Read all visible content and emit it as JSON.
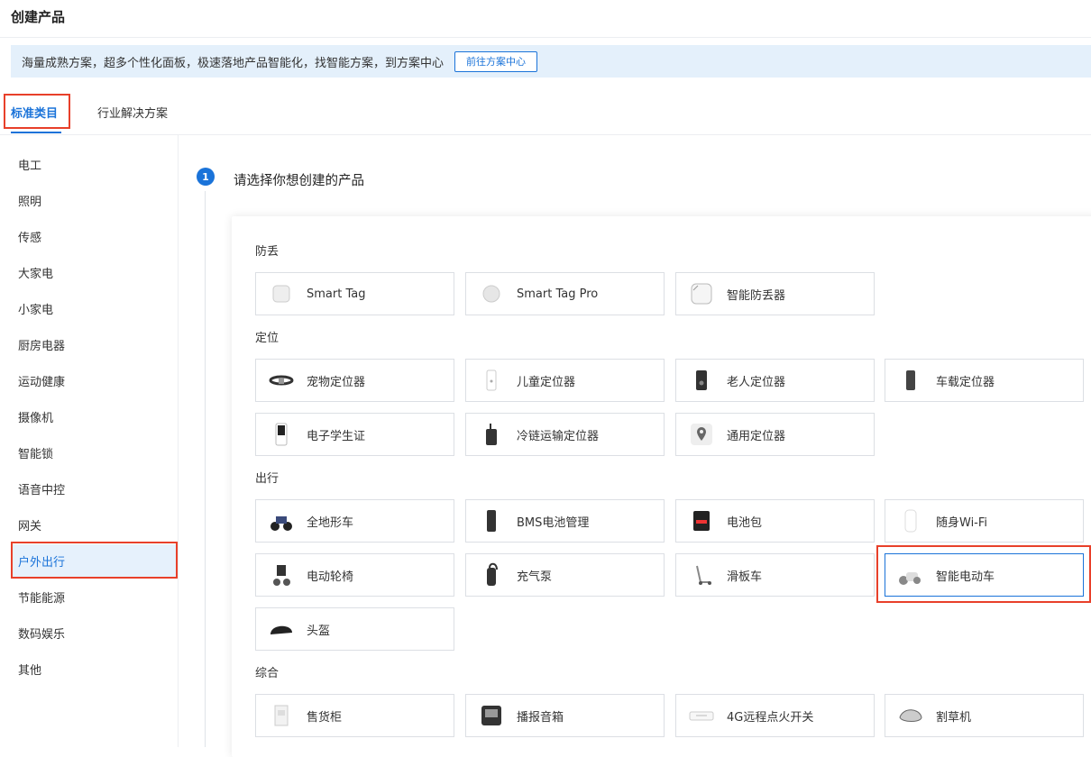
{
  "page": {
    "title": "创建产品"
  },
  "banner": {
    "text": "海量成熟方案，超多个性化面板，极速落地产品智能化，找智能方案，到方案中心",
    "button_label": "前往方案中心"
  },
  "tabs": [
    {
      "label": "标准类目",
      "active": true
    },
    {
      "label": "行业解决方案",
      "active": false
    }
  ],
  "sidebar": {
    "items": [
      {
        "label": "电工"
      },
      {
        "label": "照明"
      },
      {
        "label": "传感"
      },
      {
        "label": "大家电"
      },
      {
        "label": "小家电"
      },
      {
        "label": "厨房电器"
      },
      {
        "label": "运动健康"
      },
      {
        "label": "摄像机"
      },
      {
        "label": "智能锁"
      },
      {
        "label": "语音中控"
      },
      {
        "label": "网关"
      },
      {
        "label": "户外出行",
        "active": true
      },
      {
        "label": "节能能源"
      },
      {
        "label": "数码娱乐"
      },
      {
        "label": "其他"
      }
    ]
  },
  "step": {
    "number": "1",
    "text": "请选择你想创建的产品"
  },
  "sections": [
    {
      "title": "防丢",
      "products": [
        {
          "label": "Smart Tag",
          "icon": "tag-square-icon"
        },
        {
          "label": "Smart Tag Pro",
          "icon": "tag-round-icon"
        },
        {
          "label": "智能防丢器",
          "icon": "anti-lost-device-icon"
        }
      ]
    },
    {
      "title": "定位",
      "products": [
        {
          "label": "宠物定位器",
          "icon": "pet-collar-icon"
        },
        {
          "label": "儿童定位器",
          "icon": "child-tracker-icon"
        },
        {
          "label": "老人定位器",
          "icon": "elder-tracker-icon"
        },
        {
          "label": "车载定位器",
          "icon": "vehicle-tracker-icon"
        },
        {
          "label": "电子学生证",
          "icon": "student-card-icon"
        },
        {
          "label": "冷链运输定位器",
          "icon": "cold-chain-tracker-icon"
        },
        {
          "label": "通用定位器",
          "icon": "location-pin-icon"
        }
      ]
    },
    {
      "title": "出行",
      "products": [
        {
          "label": "全地形车",
          "icon": "atv-icon"
        },
        {
          "label": "BMS电池管理",
          "icon": "bms-battery-icon"
        },
        {
          "label": "电池包",
          "icon": "battery-pack-icon"
        },
        {
          "label": "随身Wi-Fi",
          "icon": "portable-wifi-icon"
        },
        {
          "label": "电动轮椅",
          "icon": "wheelchair-icon"
        },
        {
          "label": "充气泵",
          "icon": "air-pump-icon"
        },
        {
          "label": "滑板车",
          "icon": "scooter-icon"
        },
        {
          "label": "智能电动车",
          "icon": "e-bike-icon",
          "selected": true
        },
        {
          "label": "头盔",
          "icon": "helmet-icon"
        }
      ]
    },
    {
      "title": "综合",
      "products": [
        {
          "label": "售货柜",
          "icon": "vending-cabinet-icon"
        },
        {
          "label": "播报音箱",
          "icon": "speaker-icon"
        },
        {
          "label": "4G远程点火开关",
          "icon": "ignition-switch-icon"
        },
        {
          "label": "割草机",
          "icon": "lawn-mower-icon"
        }
      ]
    }
  ]
}
